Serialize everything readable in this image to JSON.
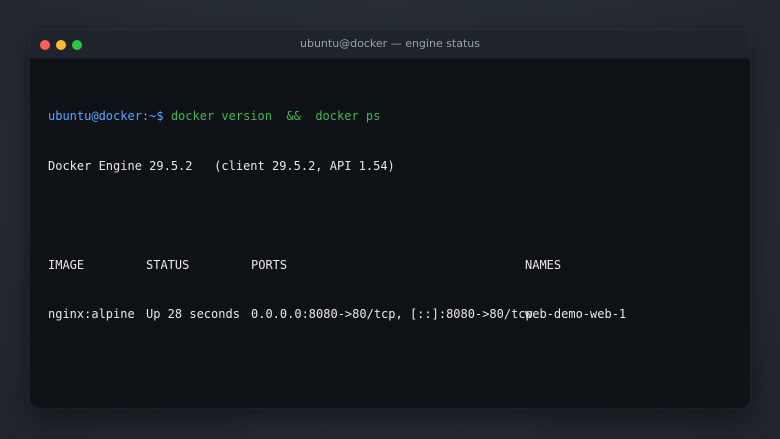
{
  "window": {
    "title": "ubuntu@docker — engine status",
    "controls": {
      "close_color": "#ff5f57",
      "minimize_color": "#febc2e",
      "maximize_color": "#28c840"
    }
  },
  "terminal": {
    "prompt": "ubuntu@docker:~$ ",
    "command": "docker version  &&  docker ps",
    "version_line": "Docker Engine 29.5.2   (client 29.5.2, API 1.54)",
    "table": {
      "headers": [
        "IMAGE",
        "STATUS",
        "PORTS",
        "NAMES"
      ],
      "rows": [
        [
          "nginx:alpine",
          "Up 28 seconds",
          "0.0.0.0:8080->80/tcp, [::]:8080->80/tcp",
          "web-demo-web-1"
        ]
      ]
    },
    "colors": {
      "prompt": "#58a6ff",
      "command": "#3fb950",
      "text": "#e6e8eb",
      "background": "#0e1116"
    }
  }
}
